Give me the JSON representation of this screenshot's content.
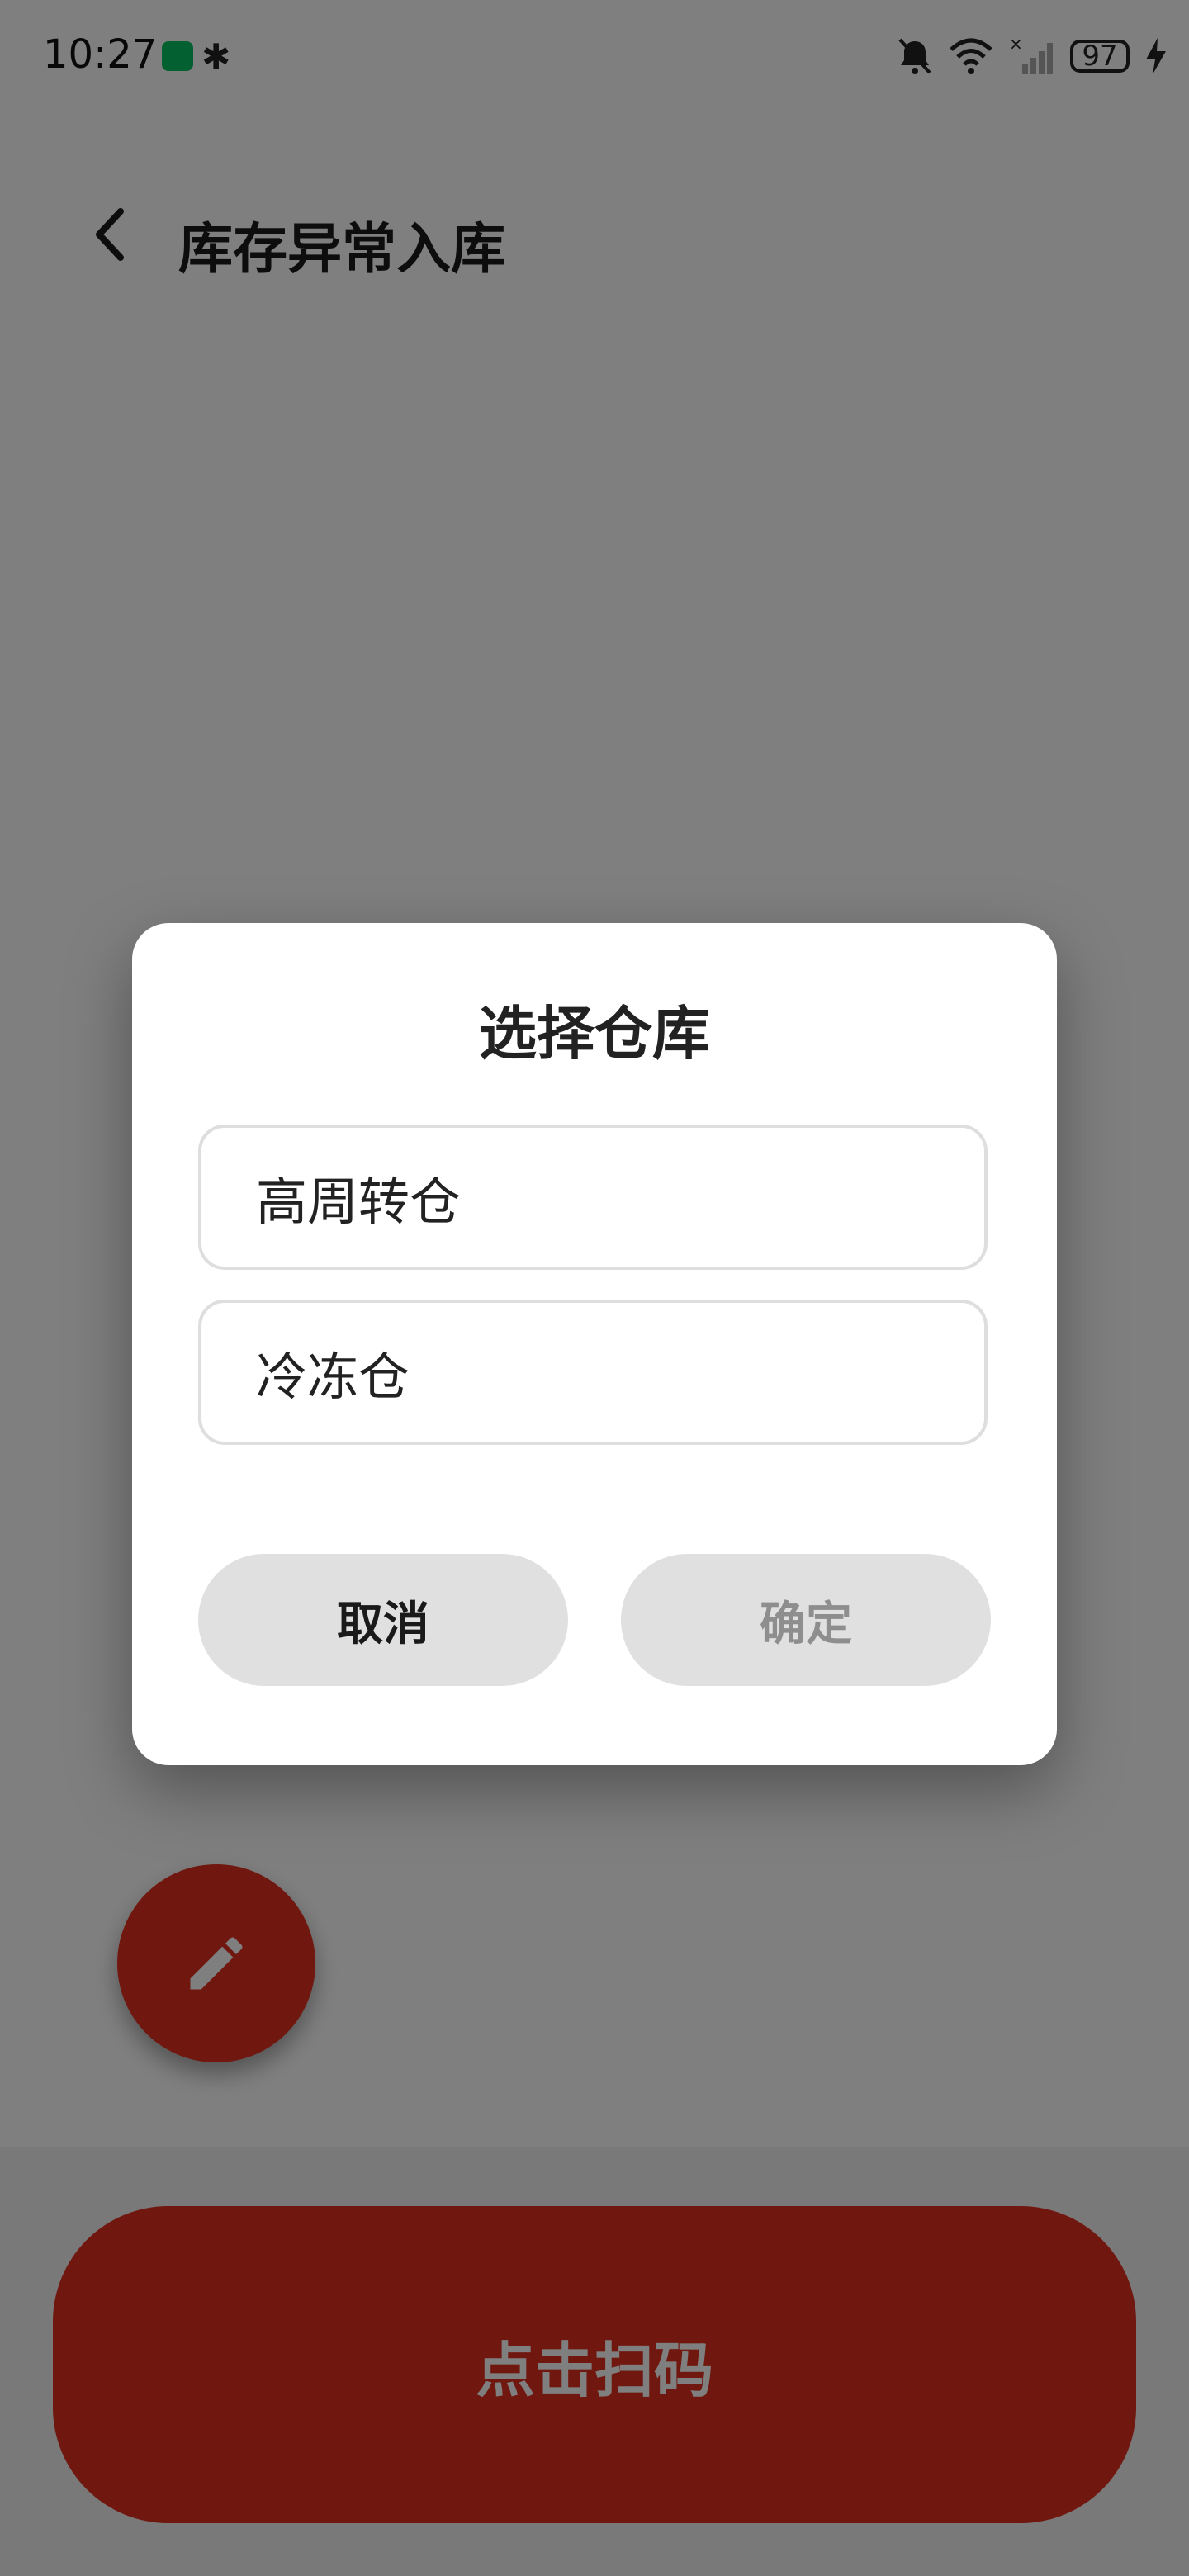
{
  "status_bar": {
    "time": "10:27",
    "battery": "97",
    "icons": [
      "wechat-icon",
      "bluetooth-icon",
      "mute-bell-icon",
      "wifi-icon",
      "no-signal-icon",
      "battery-icon",
      "charging-bolt-icon"
    ]
  },
  "header": {
    "title": "库存异常入库",
    "back_icon": "chevron-left-icon"
  },
  "fab": {
    "icon": "pencil-icon",
    "color": "#e1301f"
  },
  "bottom": {
    "scan_label": "点击扫码",
    "color": "#e1301f"
  },
  "dialog": {
    "title": "选择仓库",
    "options": [
      {
        "label": "高周转仓"
      },
      {
        "label": "冷冻仓"
      }
    ],
    "cancel_label": "取消",
    "confirm_label": "确定"
  },
  "colors": {
    "accent": "#e1301f",
    "overlay": "rgba(0,0,0,0.5)",
    "button_bg": "#e0e0e0"
  }
}
